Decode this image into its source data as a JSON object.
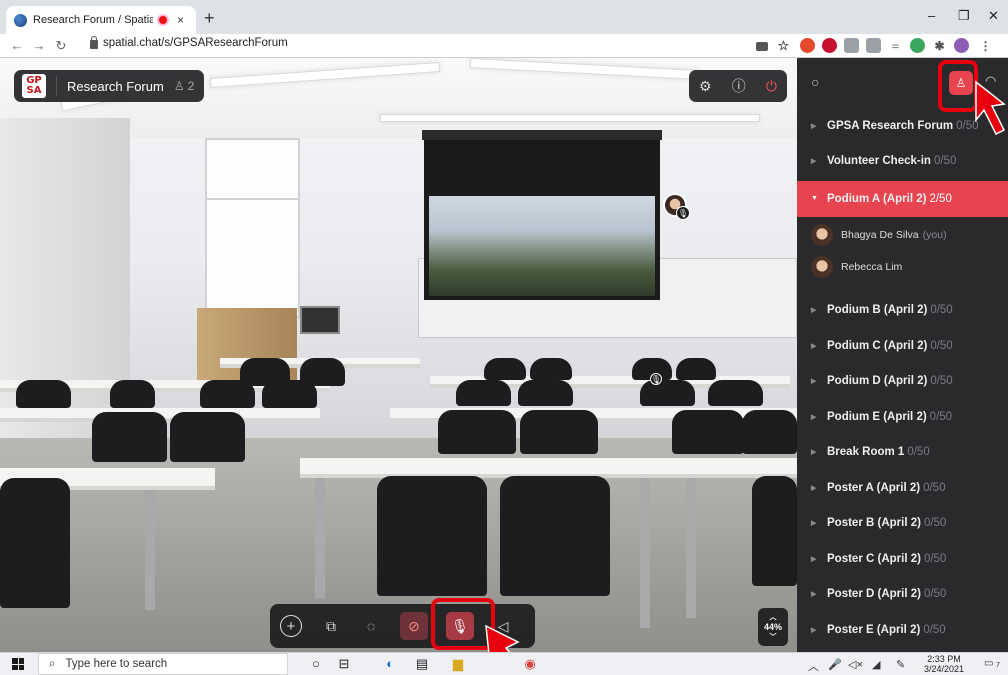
{
  "browser": {
    "tab_title": "Research Forum / SpatialChat",
    "tab_close": "×",
    "new_tab": "+",
    "url": "spatial.chat/s/GPSAResearchForum",
    "window_controls": {
      "minimize": "–",
      "restore": "❐",
      "close": "✕"
    }
  },
  "room": {
    "logo_top": "GP",
    "logo_bottom": "SA",
    "title": "Research Forum",
    "user_count": "2",
    "zoom": "44%"
  },
  "sidebar": {
    "rooms_before": [
      {
        "name": "GPSA Research Forum",
        "capacity": "0/50"
      },
      {
        "name": "Volunteer Check-in",
        "capacity": "0/50"
      }
    ],
    "active_room": {
      "name": "Podium A (April 2)",
      "capacity": "2/50"
    },
    "people": [
      {
        "name": "Bhagya De Silva",
        "tag": "(you)"
      },
      {
        "name": "Rebecca Lim",
        "tag": ""
      }
    ],
    "rooms_after": [
      {
        "name": "Podium B (April 2)",
        "capacity": "0/50"
      },
      {
        "name": "Podium C (April 2)",
        "capacity": "0/50"
      },
      {
        "name": "Podium D (April 2)",
        "capacity": "0/50"
      },
      {
        "name": "Podium E (April 2)",
        "capacity": "0/50"
      },
      {
        "name": "Break Room 1",
        "capacity": "0/50"
      },
      {
        "name": "Poster A (April 2)",
        "capacity": "0/50"
      },
      {
        "name": "Poster B (April 2)",
        "capacity": "0/50"
      },
      {
        "name": "Poster C (April 2)",
        "capacity": "0/50"
      },
      {
        "name": "Poster D (April 2)",
        "capacity": "0/50"
      },
      {
        "name": "Poster E (April 2)",
        "capacity": "0/50"
      }
    ]
  },
  "taskbar": {
    "search_placeholder": "Type here to search",
    "time": "2:33 PM",
    "date": "3/24/2021",
    "notifications": "7"
  },
  "colors": {
    "accent": "#e8444f",
    "highlight": "#e8000e",
    "sidebar_bg": "#2a2a2d"
  },
  "icons": {
    "top_controls": [
      "gear-icon",
      "help-icon",
      "power-icon"
    ],
    "bottom_controls": [
      "plus-icon",
      "screen-share-icon",
      "chat-icon",
      "camera-off-icon",
      "mic-off-icon",
      "speaker-icon"
    ]
  }
}
